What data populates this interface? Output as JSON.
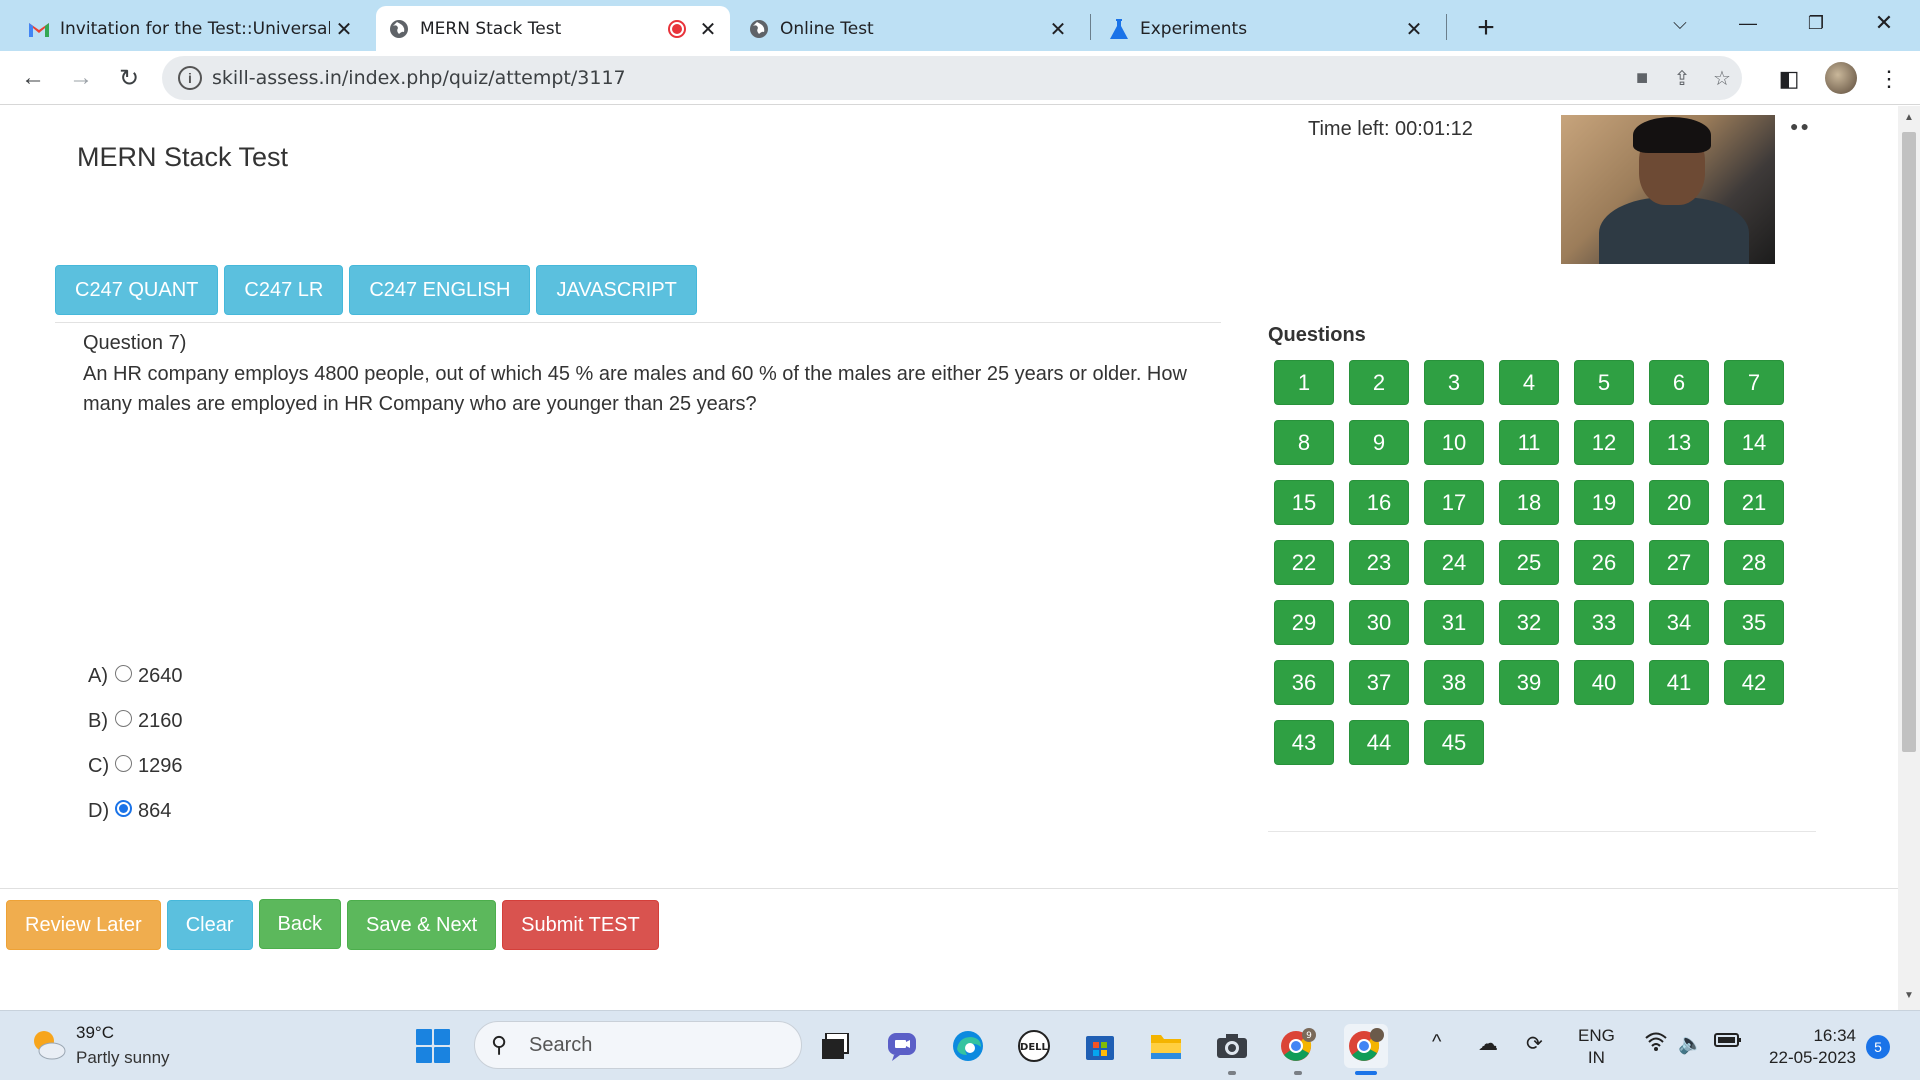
{
  "browser": {
    "tabs": [
      {
        "title": "Invitation for the Test::Universal I",
        "favicon": "gmail-icon",
        "active": false
      },
      {
        "title": "MERN Stack Test",
        "favicon": "globe-icon",
        "active": true,
        "recording": true
      },
      {
        "title": "Online Test",
        "favicon": "globe-icon",
        "active": false
      },
      {
        "title": "Experiments",
        "favicon": "flask-icon",
        "active": false
      }
    ],
    "url": "skill-assess.in/index.php/quiz/attempt/3117"
  },
  "quiz": {
    "title": "MERN Stack Test",
    "time_left": "Time left: 00:01:12",
    "sections": [
      "C247 QUANT",
      "C247 LR",
      "C247 ENGLISH",
      "JAVASCRIPT"
    ],
    "question_number": "Question 7)",
    "question_text": "An HR company employs 4800 people, out of which 45 % are males and 60 % of the males are either 25 years or older. How many males are employed in HR Company who are younger than 25 years?",
    "options": [
      {
        "letter": "A)",
        "value": "2640",
        "selected": false
      },
      {
        "letter": "B)",
        "value": "2160",
        "selected": false
      },
      {
        "letter": "C)",
        "value": "1296",
        "selected": false
      },
      {
        "letter": "D)",
        "value": "864",
        "selected": true
      }
    ],
    "questions_heading": "Questions",
    "question_buttons": [
      "1",
      "2",
      "3",
      "4",
      "5",
      "6",
      "7",
      "8",
      "9",
      "10",
      "11",
      "12",
      "13",
      "14",
      "15",
      "16",
      "17",
      "18",
      "19",
      "20",
      "21",
      "22",
      "23",
      "24",
      "25",
      "26",
      "27",
      "28",
      "29",
      "30",
      "31",
      "32",
      "33",
      "34",
      "35",
      "36",
      "37",
      "38",
      "39",
      "40",
      "41",
      "42",
      "43",
      "44",
      "45"
    ],
    "actions": {
      "review_later": "Review Later",
      "clear": "Clear",
      "back": "Back",
      "save_next": "Save & Next",
      "submit": "Submit TEST"
    }
  },
  "taskbar": {
    "weather_temp": "39°C",
    "weather_desc": "Partly sunny",
    "search_label": "Search",
    "lang_top": "ENG",
    "lang_bottom": "IN",
    "time": "16:34",
    "date": "22-05-2023",
    "notifications": "5",
    "chrome_badge": "9"
  },
  "colors": {
    "question_button": "#2fa043",
    "section_button": "#5bc0de",
    "tabbar": "#bde0f4",
    "radio_selected": "#1a73e8"
  }
}
